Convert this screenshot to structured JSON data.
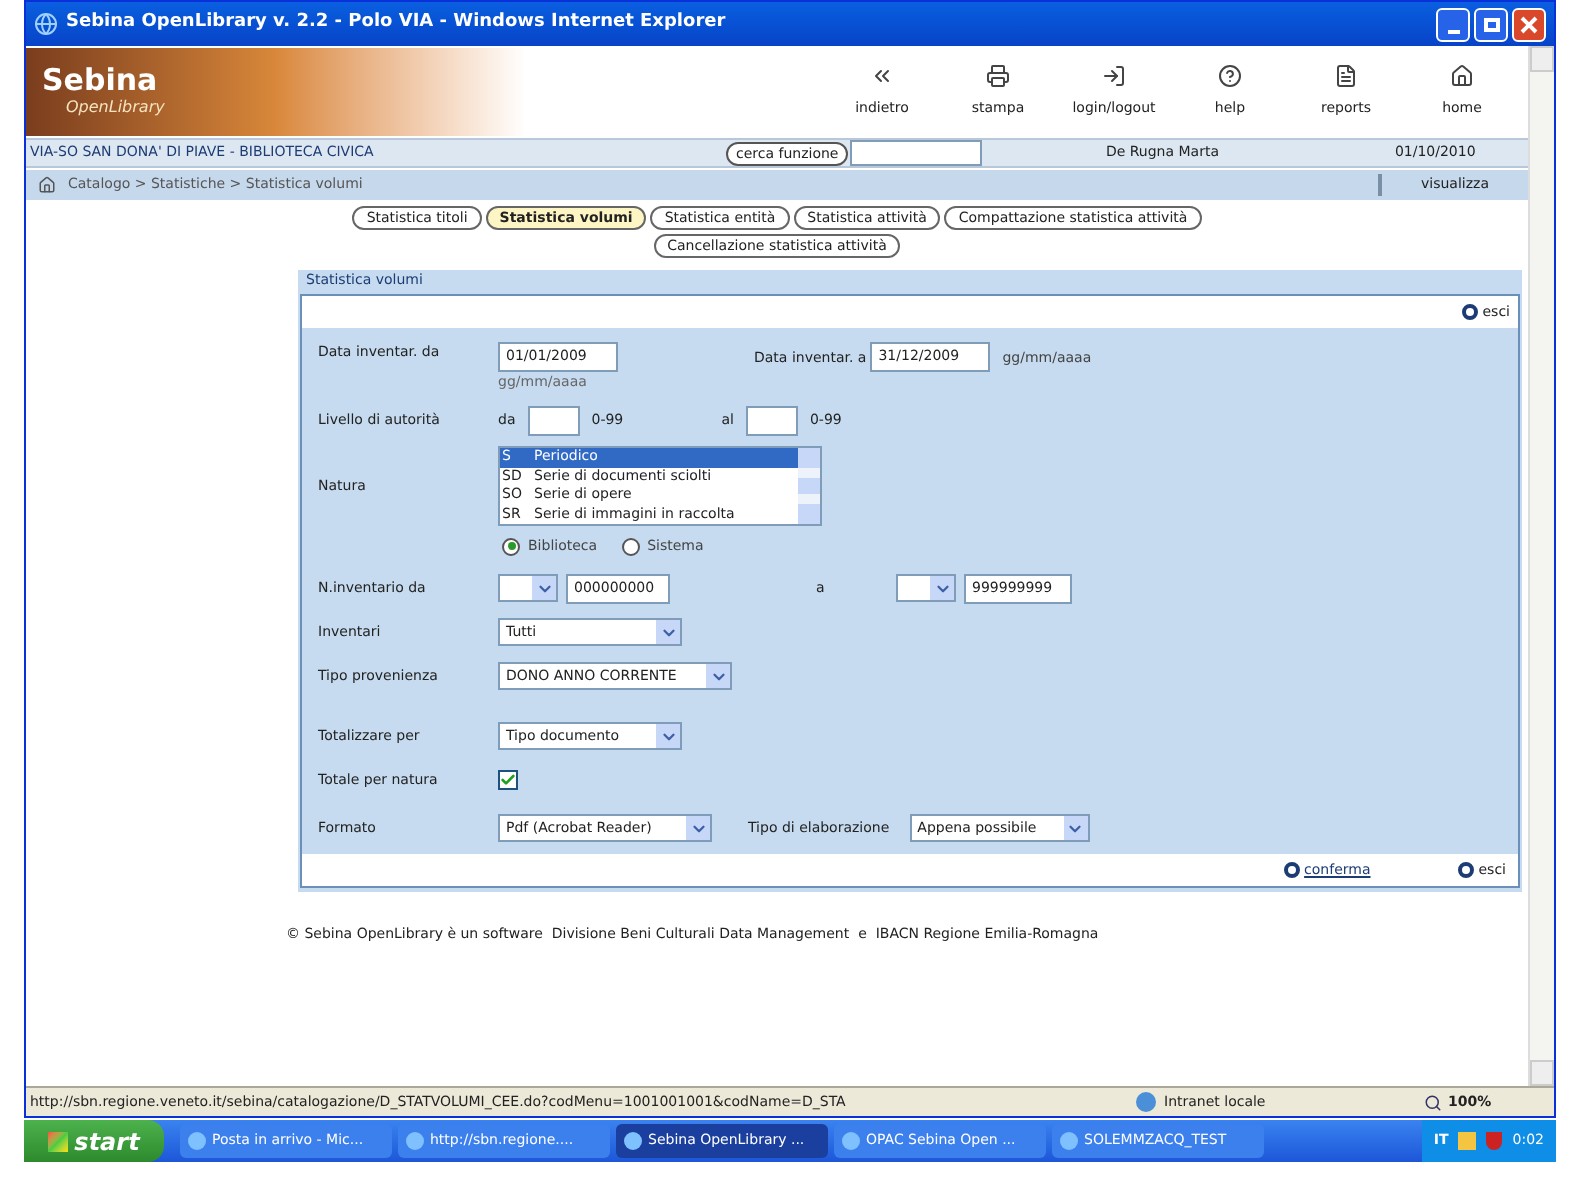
{
  "window": {
    "title": "Sebina OpenLibrary v. 2.2 - Polo VIA - Windows Internet Explorer"
  },
  "logo": {
    "title": "Sebina",
    "subtitle": "OpenLibrary"
  },
  "nav": [
    {
      "kind": "back",
      "label": "indietro"
    },
    {
      "kind": "print",
      "label": "stampa"
    },
    {
      "kind": "login",
      "label": "login/logout"
    },
    {
      "kind": "help",
      "label": "help"
    },
    {
      "kind": "reports",
      "label": "reports"
    },
    {
      "kind": "home",
      "label": "home"
    }
  ],
  "info_bar": {
    "library": "VIA-SO SAN DONA' DI PIAVE - BIBLIOTECA CIVICA",
    "search_button": "cerca funzione",
    "user": "De Rugna Marta",
    "date": "01/10/2010"
  },
  "breadcrumb": {
    "path": "Catalogo > Statistiche > Statistica volumi",
    "action": "visualizza"
  },
  "tabs": [
    {
      "label": "Statistica titoli",
      "selected": false
    },
    {
      "label": "Statistica volumi",
      "selected": true
    },
    {
      "label": "Statistica entità",
      "selected": false
    },
    {
      "label": "Statistica attività",
      "selected": false
    },
    {
      "label": "Compattazione statistica attività",
      "selected": false
    },
    {
      "label": "Cancellazione statistica attività",
      "selected": false
    }
  ],
  "panel": {
    "title": "Statistica volumi",
    "close": "esci",
    "date_from": {
      "label": "Data inventar. da",
      "value": "01/01/2009",
      "hint": "gg/mm/aaaa"
    },
    "date_to": {
      "label": "Data inventar. a",
      "value": "31/12/2009",
      "hint": "gg/mm/aaaa"
    },
    "level": {
      "label": "Livello di autorità",
      "from_label": "da",
      "from_range": "0-99",
      "to_label": "al",
      "to_range": "0-99"
    },
    "natura": {
      "label": "Natura",
      "options": [
        {
          "code": "S",
          "text": "Periodico",
          "selected": true
        },
        {
          "code": "SD",
          "text": "Serie di documenti sciolti",
          "selected": false
        },
        {
          "code": "SO",
          "text": "Serie di opere",
          "selected": false
        },
        {
          "code": "SR",
          "text": "Serie di immagini in raccolta",
          "selected": false
        }
      ]
    },
    "scope": [
      {
        "label": "Biblioteca",
        "selected": true
      },
      {
        "label": "Sistema",
        "selected": false
      }
    ],
    "inventory": {
      "label": "N.inventario da",
      "from": "000000000",
      "to_label": "a",
      "to": "999999999"
    },
    "selects": [
      {
        "label": "Inventari",
        "value": "Tutti"
      },
      {
        "label": "Tipo provenienza",
        "value": "DONO ANNO CORRENTE"
      },
      {
        "label": "Totalizzare per",
        "value": "Tipo documento"
      }
    ],
    "total_by_nature": {
      "label": "Totale per natura",
      "checked": true
    },
    "format": {
      "label": "Formato",
      "value": "Pdf (Acrobat Reader)",
      "processing_label": "Tipo di elaborazione",
      "processing": "Appena possibile"
    },
    "confirm": "conferma",
    "exit": "esci"
  },
  "footer": "© Sebina OpenLibrary è un software  Divisione Beni Culturali Data Management  e  IBACN Regione Emilia-Romagna",
  "status_bar": {
    "url": "http://sbn.regione.veneto.it/sebina/catalogazione/D_STATVOLUMI_CEE.do?codMenu=1001001001&codName=D_STA",
    "zone": "Intranet locale",
    "zoom": "100%"
  },
  "taskbar": {
    "start": "start",
    "items": [
      {
        "label": "Posta in arrivo - Mic...",
        "selected": false
      },
      {
        "label": "http://sbn.regione....",
        "selected": false
      },
      {
        "label": "Sebina OpenLibrary ...",
        "selected": true
      },
      {
        "label": "OPAC Sebina Open ...",
        "selected": false
      },
      {
        "label": "SOLEMMZACQ_TEST",
        "selected": false
      }
    ],
    "language": "IT",
    "time": "0:02"
  }
}
